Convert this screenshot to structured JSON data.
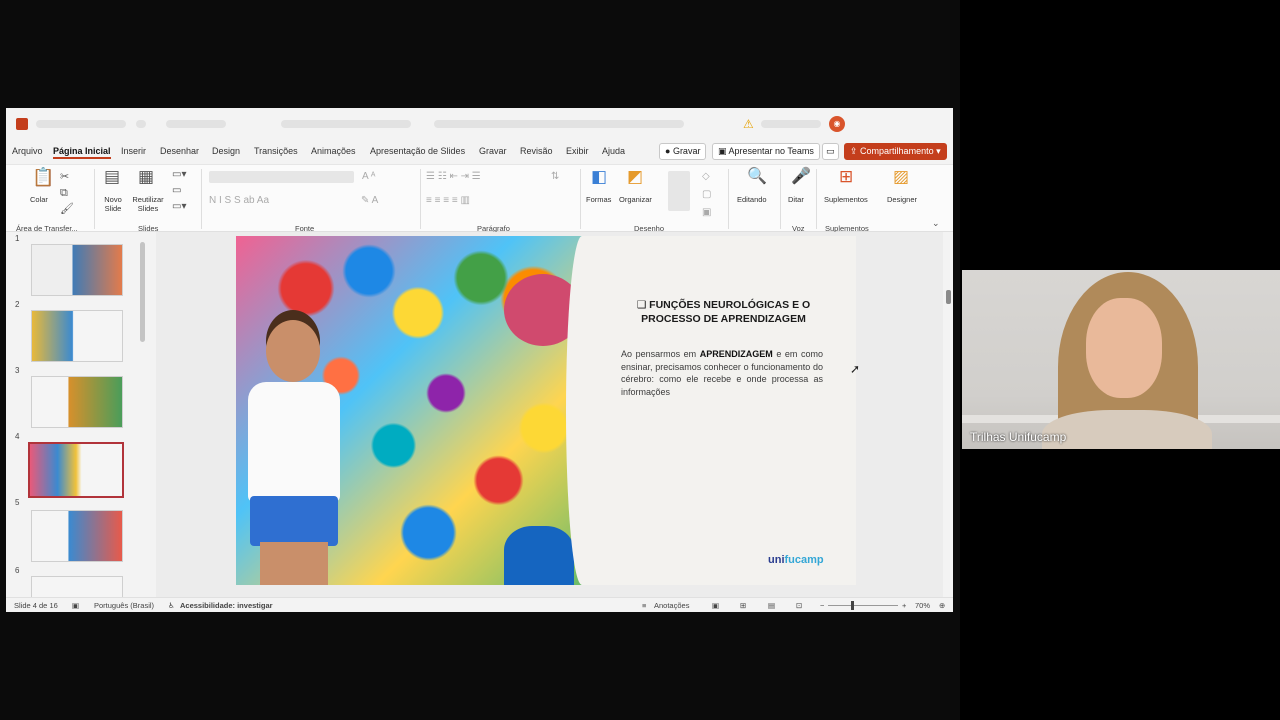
{
  "menu": {
    "items": [
      "Arquivo",
      "Página Inicial",
      "Inserir",
      "Desenhar",
      "Design",
      "Transições",
      "Animações",
      "Apresentação de Slides",
      "Gravar",
      "Revisão",
      "Exibir",
      "Ajuda"
    ],
    "active": "Página Inicial",
    "record_label": "Gravar",
    "teams_label": "Apresentar no Teams",
    "share_label": "Compartilhamento"
  },
  "ribbon": {
    "paste": "Colar",
    "new_slide": "Novo Slide",
    "reuse_slides": "Reutilizar Slides",
    "shapes": "Formas",
    "arrange": "Organizar",
    "editing": "Editando",
    "dictate": "Ditar",
    "addins": "Suplementos",
    "designer": "Designer",
    "groups": {
      "clipboard": "Área de Transfer...",
      "slides": "Slides",
      "font": "Fonte",
      "paragraph": "Parágrafo",
      "drawing": "Desenho",
      "voice": "Voz",
      "addins": "Suplementos"
    }
  },
  "thumbnails": [
    {
      "number": "1"
    },
    {
      "number": "2"
    },
    {
      "number": "3"
    },
    {
      "number": "4",
      "selected": true
    },
    {
      "number": "5"
    },
    {
      "number": "6"
    }
  ],
  "slide": {
    "title": "❑ FUNÇÕES NEUROLÓGICAS E O PROCESSO DE APRENDIZAGEM",
    "body_pre": "Ao pensarmos em ",
    "body_bold": "APRENDIZAGEM",
    "body_post": " e em como ensinar, precisamos conhecer o funcionamento do cérebro: como ele recebe e onde processa as informações",
    "brand_part1": "uni",
    "brand_part2": "fucamp"
  },
  "status": {
    "slide_count": "Slide 4 de 16",
    "language": "Português (Brasil)",
    "accessibility": "Acessibilidade: investigar",
    "notes": "Anotações",
    "zoom": "70%"
  },
  "webcam": {
    "name": "Trilhas Unifucamp"
  },
  "colors": {
    "accent": "#c43e1c",
    "selected_thumb": "#b1333a",
    "brand_blue": "#2a3d8f"
  }
}
